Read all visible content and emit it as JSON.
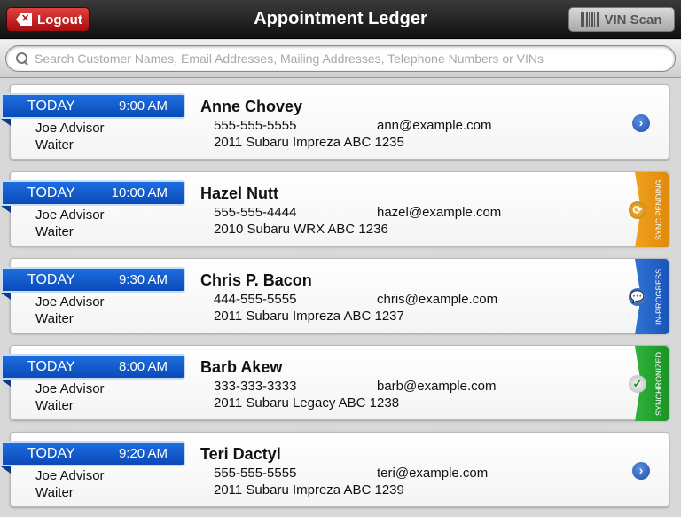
{
  "header": {
    "title": "Appointment Ledger",
    "logout_label": "Logout",
    "vin_label": "VIN Scan"
  },
  "search": {
    "placeholder": "Search Customer Names, Email Addresses, Mailing Addresses, Telephone Numbers or VINs"
  },
  "colors": {
    "ribbon_blue": "#0a4ab8",
    "sync_pending": "#e8920c",
    "in_progress": "#1f5fbf",
    "synchronized": "#1e9e2a"
  },
  "appointments": [
    {
      "day": "TODAY",
      "time": "9:00 AM",
      "name": "Anne Chovey",
      "advisor": "Joe Advisor",
      "type": "Waiter",
      "phone": "555-555-5555",
      "email": "ann@example.com",
      "vehicle": "2011 Subaru Impreza ABC 1235",
      "status": "",
      "status_icon": "chevron-right-icon"
    },
    {
      "day": "TODAY",
      "time": "10:00 AM",
      "name": "Hazel Nutt",
      "advisor": "Joe Advisor",
      "type": "Waiter",
      "phone": "555-555-4444",
      "email": "hazel@example.com",
      "vehicle": "2010 Subaru WRX ABC 1236",
      "status": "SYNC PENDING",
      "status_icon": "sync-icon"
    },
    {
      "day": "TODAY",
      "time": "9:30 AM",
      "name": "Chris P. Bacon",
      "advisor": "Joe Advisor",
      "type": "Waiter",
      "phone": "444-555-5555",
      "email": "chris@example.com",
      "vehicle": "2011 Subaru Impreza ABC 1237",
      "status": "IN-PROGRESS",
      "status_icon": "chat-bubble-icon"
    },
    {
      "day": "TODAY",
      "time": "8:00 AM",
      "name": "Barb Akew",
      "advisor": "Joe Advisor",
      "type": "Waiter",
      "phone": "333-333-3333",
      "email": "barb@example.com",
      "vehicle": "2011 Subaru Legacy ABC 1238",
      "status": "SYNCHRONIZED",
      "status_icon": "checkmark-icon"
    },
    {
      "day": "TODAY",
      "time": "9:20 AM",
      "name": "Teri Dactyl",
      "advisor": "Joe Advisor",
      "type": "Waiter",
      "phone": "555-555-5555",
      "email": "teri@example.com",
      "vehicle": "2011 Subaru Impreza ABC 1239",
      "status": "",
      "status_icon": "chevron-right-icon"
    }
  ]
}
